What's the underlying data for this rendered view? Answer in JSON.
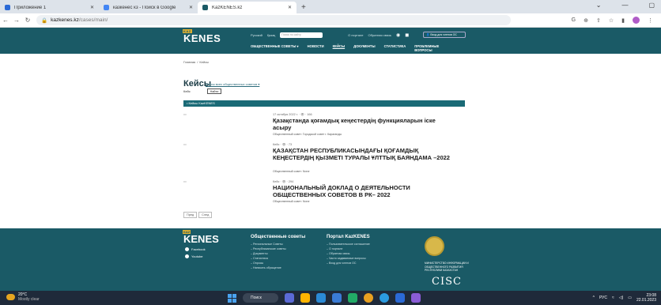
{
  "browser": {
    "tabs": [
      {
        "label": "Приложение 1",
        "color": "#2b6ad6"
      },
      {
        "label": "казкенес кз - Поиск в Google",
        "color": "#4285f4"
      },
      {
        "label": "KazKENES.kz",
        "color": "#1a5a66"
      }
    ],
    "new_tab": "+",
    "url_host": "kazkenes.kz",
    "url_path": "/cases/main/"
  },
  "site": {
    "logo_badge": "KAZ",
    "logo_text": "KENES",
    "lang_ru": "Русский",
    "lang_kz": "Қазақ",
    "search_placeholder": "Поиск по сайту",
    "about": "О портале",
    "feedback": "Обратная связь",
    "login": "Вход для членов ОС",
    "nav": [
      "ОБЩЕСТВЕННЫЕ СОВЕТЫ ▾",
      "НОВОСТИ",
      "КЕЙСЫ",
      "ДОКУМЕНТЫ",
      "СТАТИСТИКА",
      "ПРОБЛЕМНЫЕ ВОПРОСЫ"
    ]
  },
  "breadcrumb": [
    "Главная",
    "/",
    "Кейсы"
  ],
  "page": {
    "title": "Кейсы",
    "title_link": "Кейсы всех общественных советов ▾",
    "filter_label": "Кейс",
    "filter_button": "Найти",
    "section": "• Кейсы KazKENES"
  },
  "cases": [
    {
      "thumb": "▭",
      "meta": "17 октября 2022 г. · 👁 · 166",
      "title": "Қазақстанда қоғамдық кеңестердің функцияларын іске асыру",
      "sub": "Общественный совет: Городской совет г. Караганды"
    },
    {
      "thumb": "▭",
      "meta": "Кейс · 👁 · 73",
      "title": "ҚАЗАҚСТАН РЕСПУБЛИКАСЫНДАҒЫ ҚОҒАМДЫҚ КЕҢЕСТЕРДІҢ ҚЫЗМЕТІ ТУРАЛЫ ҰЛТТЫҚ БАЯНДАМА –2022",
      "sub": "Общественный совет: None"
    },
    {
      "thumb": "▭",
      "meta": "Кейс · 👁 · 294",
      "title": "НАЦИОНАЛЬНЫЙ ДОКЛАД О ДЕЯТЕЛЬНОСТИ ОБЩЕСТВЕННЫХ СОВЕТОВ В РК– 2022",
      "sub": "Общественный совет: None"
    }
  ],
  "pager": [
    "Пред",
    "След"
  ],
  "footer": {
    "social": [
      "Facebook",
      "Youtube"
    ],
    "col1_title": "Общественные советы",
    "col1": [
      "Региональные Советы",
      "Республиканские советы",
      "Документы",
      "Статистика",
      "Опросы",
      "Написать обращение"
    ],
    "col2_title": "Портал KazKENES",
    "col2": [
      "Пользовательское соглашение",
      "О портале",
      "Обратная связь",
      "Часто задаваемые вопросы",
      "Вход для членов ОС"
    ],
    "org": "МИНИСТЕРСТВО ИНФОРМАЦИИ И ОБЩЕСТВЕННОГО РАЗВИТИЯ РЕСПУБЛИКИ КАЗАХСТАН",
    "cisc": "CISC"
  },
  "taskbar": {
    "temp": "20°C",
    "weather": "Mostly clear",
    "search": "Поиск",
    "lang": "РУС",
    "time": "23:08",
    "date": "22.01.2023",
    "app_colors": [
      "#ffb400",
      "#2b8ad6",
      "#22aa66",
      "#3a7bd5",
      "#e55",
      "#8a5cd6",
      "#2b6ad6",
      "#e8a020"
    ]
  }
}
